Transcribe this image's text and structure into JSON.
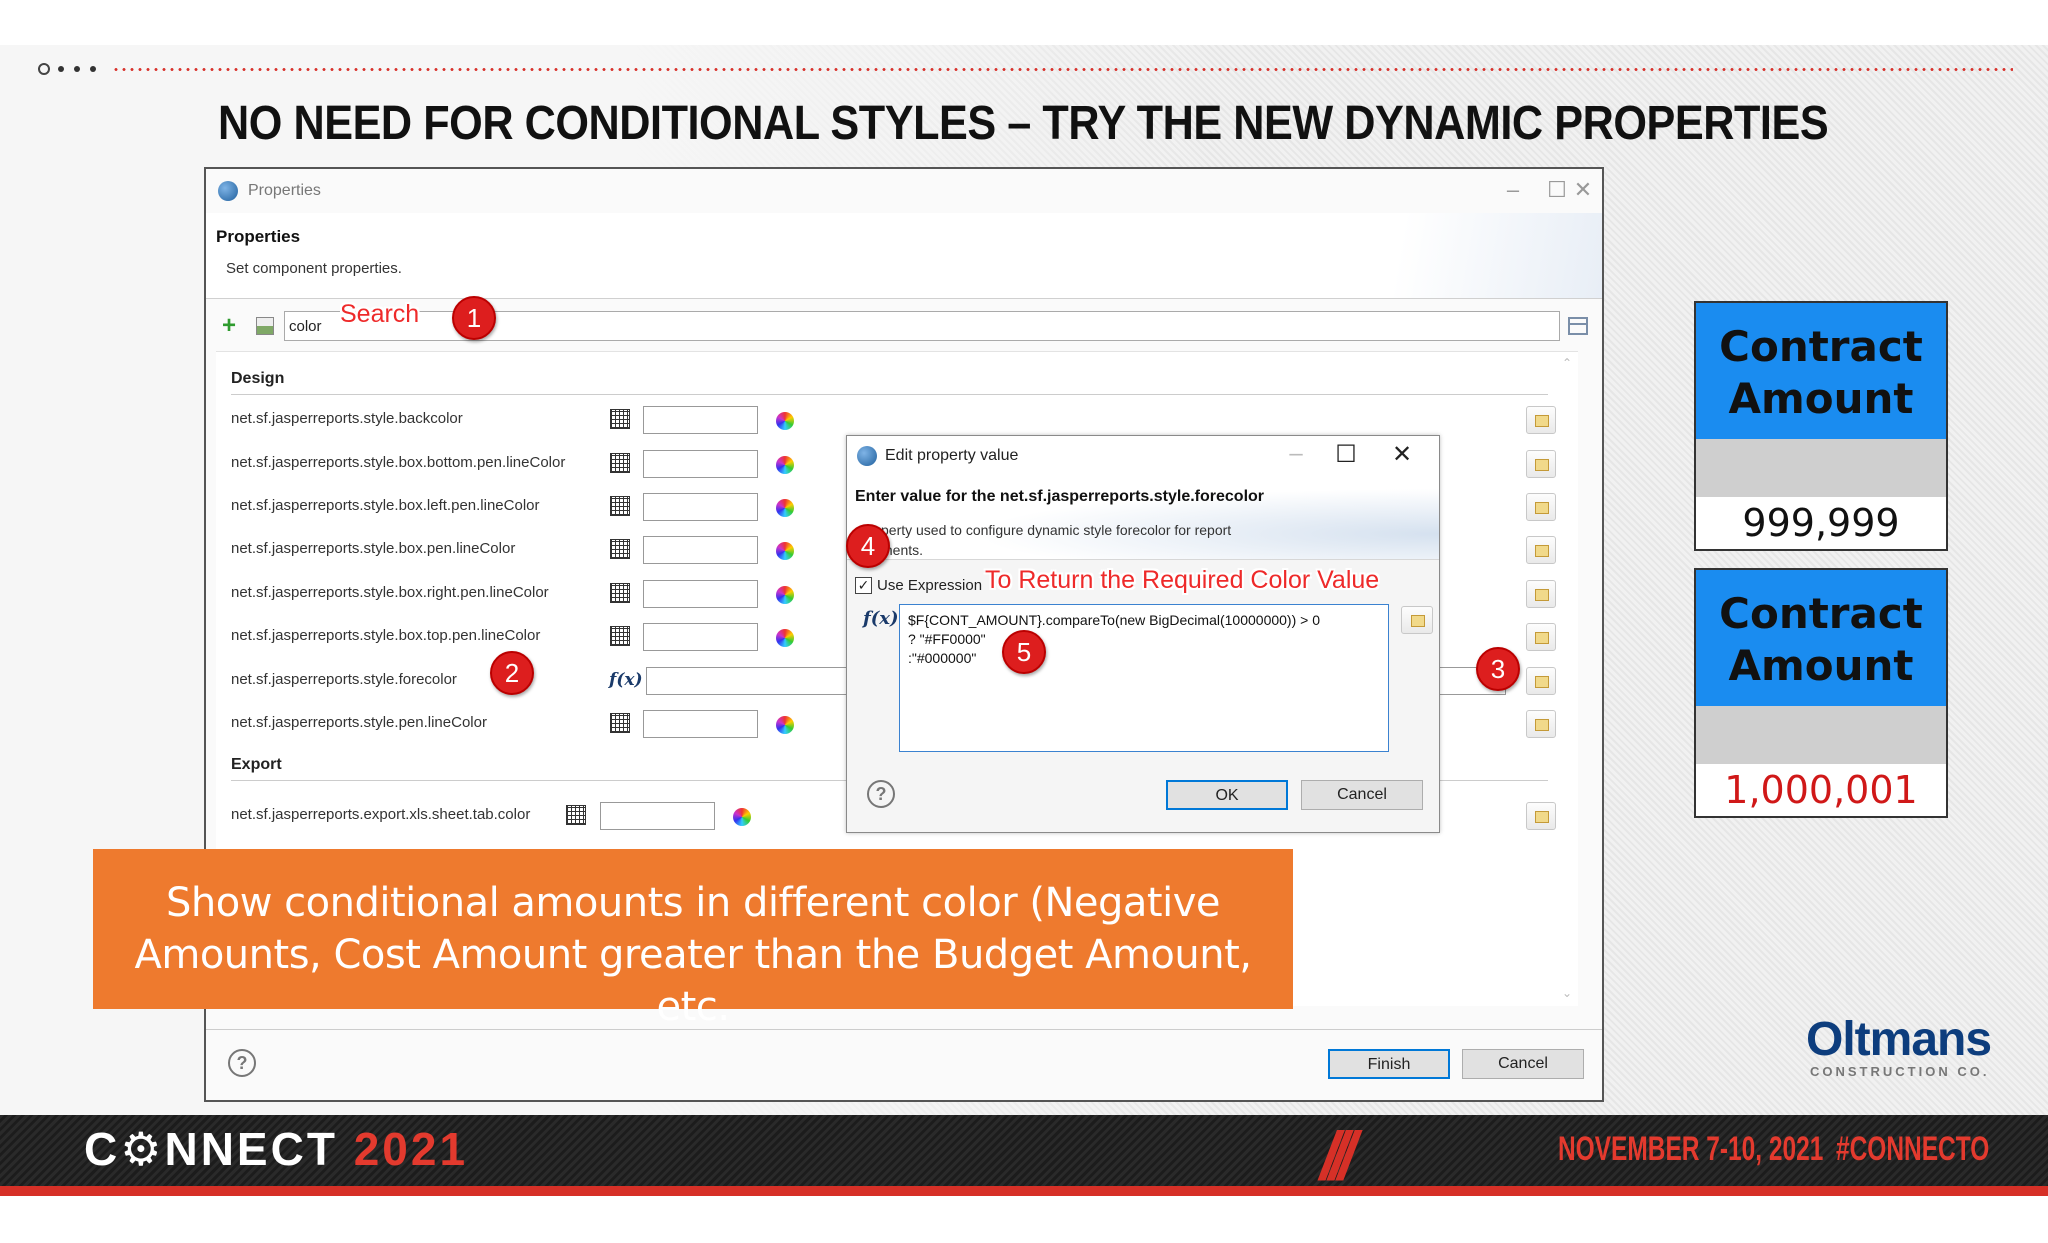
{
  "slide": {
    "title": "NO NEED FOR CONDITIONAL STYLES – TRY THE NEW DYNAMIC PROPERTIES",
    "banner_text": "Show conditional amounts in different color (Negative Amounts, Cost Amount greater than the Budget Amount, etc."
  },
  "properties_dialog": {
    "window_title": "Properties",
    "header": "Properties",
    "subheader": "Set component properties.",
    "search_value": "color",
    "sections": {
      "design": "Design",
      "export": "Export"
    },
    "design_properties": [
      {
        "name": "net.sf.jasperreports.style.backcolor",
        "editor": "color"
      },
      {
        "name": "net.sf.jasperreports.style.box.bottom.pen.lineColor",
        "editor": "color"
      },
      {
        "name": "net.sf.jasperreports.style.box.left.pen.lineColor",
        "editor": "color"
      },
      {
        "name": "net.sf.jasperreports.style.box.pen.lineColor",
        "editor": "color"
      },
      {
        "name": "net.sf.jasperreports.style.box.right.pen.lineColor",
        "editor": "color"
      },
      {
        "name": "net.sf.jasperreports.style.box.top.pen.lineColor",
        "editor": "color"
      },
      {
        "name": "net.sf.jasperreports.style.forecolor",
        "editor": "expression"
      },
      {
        "name": "net.sf.jasperreports.style.pen.lineColor",
        "editor": "color"
      }
    ],
    "export_properties": [
      {
        "name": "net.sf.jasperreports.export.xls.sheet.tab.color",
        "editor": "color"
      }
    ],
    "buttons": {
      "finish": "Finish",
      "cancel": "Cancel"
    },
    "help_glyph": "?"
  },
  "edit_dialog": {
    "window_title": "Edit property value",
    "heading": "Enter value for the net.sf.jasperreports.style.forecolor",
    "description": "Property used to configure dynamic style forecolor for report elements.",
    "description_visible": "perty used to configure dynamic style forecolor for report\nments.",
    "use_expression_label": "Use Expression",
    "use_expression_checked": true,
    "expression": "$F{CONT_AMOUNT}.compareTo(new BigDecimal(10000000)) > 0\n? \"#FF0000\"\n:\"#000000\"",
    "buttons": {
      "ok": "OK",
      "cancel": "Cancel"
    },
    "help_glyph": "?"
  },
  "annotations": {
    "callout_search": "Search",
    "callout_expression": "To Return the Required Color Value",
    "badges": [
      "1",
      "2",
      "3",
      "4",
      "5"
    ]
  },
  "sample_cards": [
    {
      "header": "Contract Amount",
      "value": "999,999",
      "value_color": "#111111"
    },
    {
      "header": "Contract Amount",
      "value": "1,000,001",
      "value_color": "#d01818"
    }
  ],
  "branding": {
    "company": "Oltmans",
    "company_sub": "CONSTRUCTION CO.",
    "event_prefix": "C",
    "event_mid": "NNECT",
    "event_year": "2021",
    "event_dates": "NOVEMBER 7-10, 2021",
    "hashtag": "#CONNECTO",
    "slashes": "///"
  },
  "colors": {
    "banner": "#ee7a2e",
    "badge": "#dd1e1e",
    "card_header": "#1a8cf0",
    "accent_red": "#d63027",
    "logo": "#0d3d7d"
  }
}
